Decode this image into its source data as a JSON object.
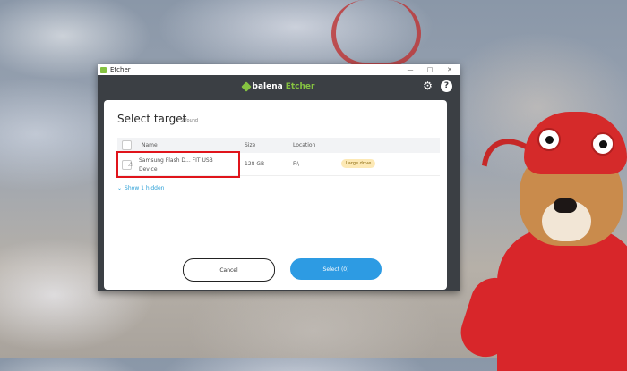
{
  "window": {
    "title": "Etcher",
    "minimize_glyph": "—",
    "maximize_glyph": "□",
    "close_glyph": "✕"
  },
  "header": {
    "brand_prefix": "balena",
    "brand_suffix": "Etcher",
    "settings_icon": "gear-icon",
    "help_icon": "question-icon",
    "help_glyph": "?"
  },
  "dialog": {
    "title": "Select target",
    "found_count": "2 found",
    "columns": {
      "name": "Name",
      "size": "Size",
      "location": "Location"
    },
    "drives": [
      {
        "name": "Samsung Flash D... FIT USB Device",
        "size": "128 GB",
        "location": "F:\\",
        "badge": "Large drive",
        "icon": "warning-icon"
      }
    ],
    "show_hidden_label": "Show 1 hidden",
    "cancel_label": "Cancel",
    "select_label": "Select (0)"
  },
  "colors": {
    "accent_blue": "#2d9be3",
    "brand_green": "#85c241",
    "highlight_red": "#e0141b",
    "badge_yellow": "#fde9b5"
  }
}
